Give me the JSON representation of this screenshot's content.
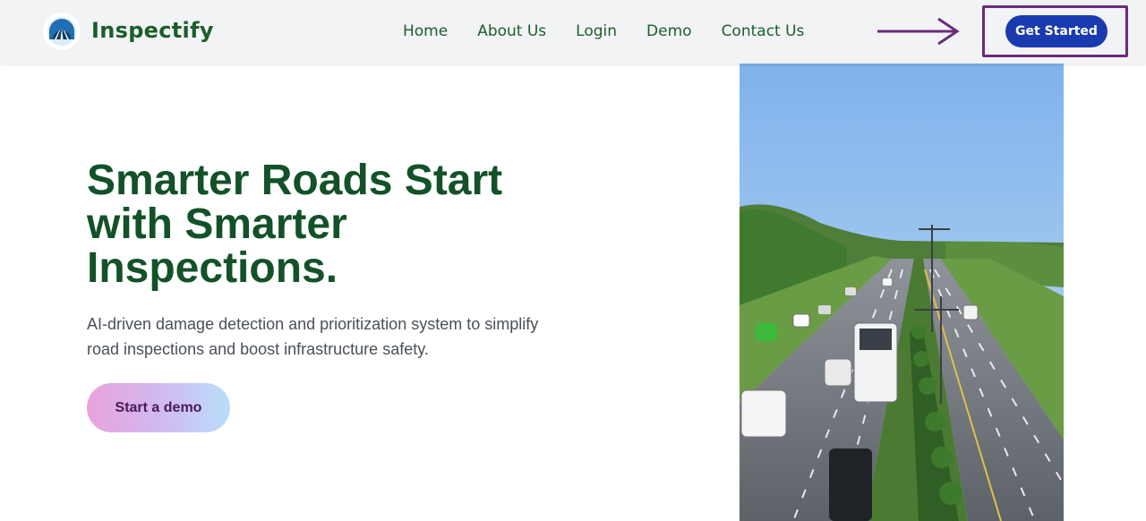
{
  "brand": {
    "name": "Inspectify",
    "logo_icon": "road-tunnel-icon"
  },
  "nav": {
    "links": [
      {
        "label": "Home"
      },
      {
        "label": "About Us"
      },
      {
        "label": "Login"
      },
      {
        "label": "Demo"
      },
      {
        "label": "Contact Us"
      }
    ],
    "cta_label": "Get Started"
  },
  "annotation": {
    "arrow_icon": "right-arrow-icon",
    "color": "#6a2c7a"
  },
  "hero": {
    "title_lines": [
      "Smarter Roads Start",
      "with Smarter",
      "Inspections."
    ],
    "subtitle": "AI-driven damage detection and prioritization system to simplify road inspections and boost infrastructure safety.",
    "demo_button": "Start a demo",
    "image_subject": "aerial-highway-photo"
  },
  "colors": {
    "brand_green": "#135228",
    "cta_blue": "#1a3aaf",
    "nav_bg": "#f2f3f5"
  }
}
